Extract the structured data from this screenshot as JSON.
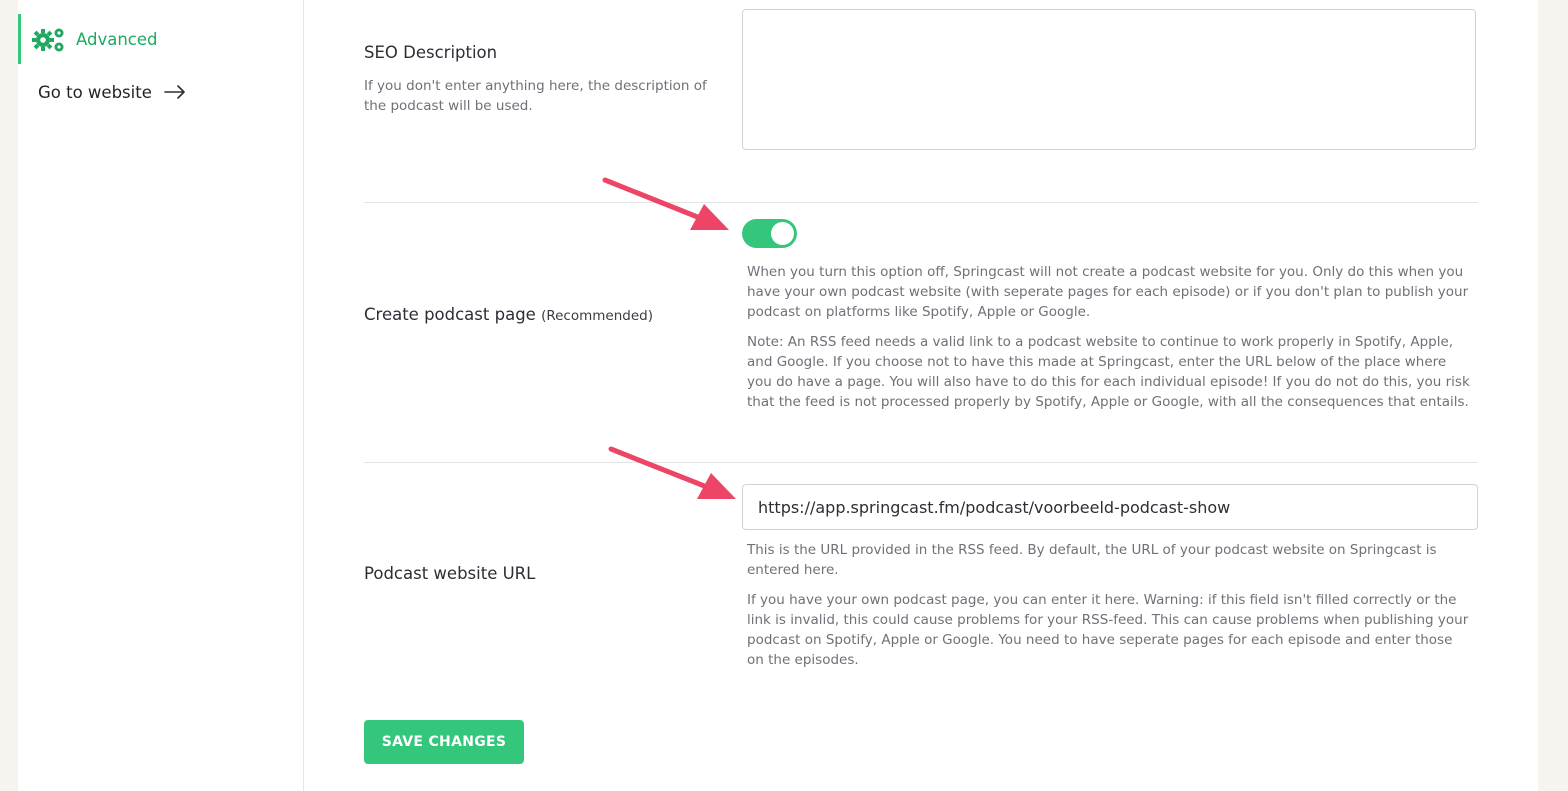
{
  "sidebar": {
    "advanced_label": "Advanced",
    "website_label": "Go to website"
  },
  "seo": {
    "label": "SEO Description",
    "help": "If you don't enter anything here, the description of the podcast will be used.",
    "value": ""
  },
  "podcast_page": {
    "label": "Create podcast page",
    "label_note": "(Recommended)",
    "toggle_on": true,
    "help1": "When you turn this option off, Springcast will not create a podcast website for you. Only do this when you have your own podcast website (with seperate pages for each episode) or if you don't plan to publish your podcast on platforms like Spotify, Apple or Google.",
    "help2": "Note: An RSS feed needs a valid link to a podcast website to continue to work properly in Spotify, Apple, and Google. If you choose not to have this made at Springcast, enter the URL below of the place where you do have a page. You will also have to do this for each individual episode! If you do not do this, you risk that the feed is not processed properly by Spotify, Apple or Google, with all the consequences that entails."
  },
  "website_url": {
    "label": "Podcast website URL",
    "value": "https://app.springcast.fm/podcast/voorbeeld-podcast-show",
    "help1": "This is the URL provided in the RSS feed. By default, the URL of your podcast website on Springcast is entered here.",
    "help2": "If you have your own podcast page, you can enter it here. Warning: if this field isn't filled correctly or the link is invalid, this could cause problems for your RSS-feed. This can cause problems when publishing your podcast on Spotify, Apple or Google. You need to have seperate pages for each episode and enter those on the episodes."
  },
  "save_label": "SAVE CHANGES",
  "colors": {
    "accent": "#34c77b",
    "annotation_arrow": "#ee4566"
  },
  "icons": [
    "gears-icon",
    "arrow-right-icon"
  ]
}
